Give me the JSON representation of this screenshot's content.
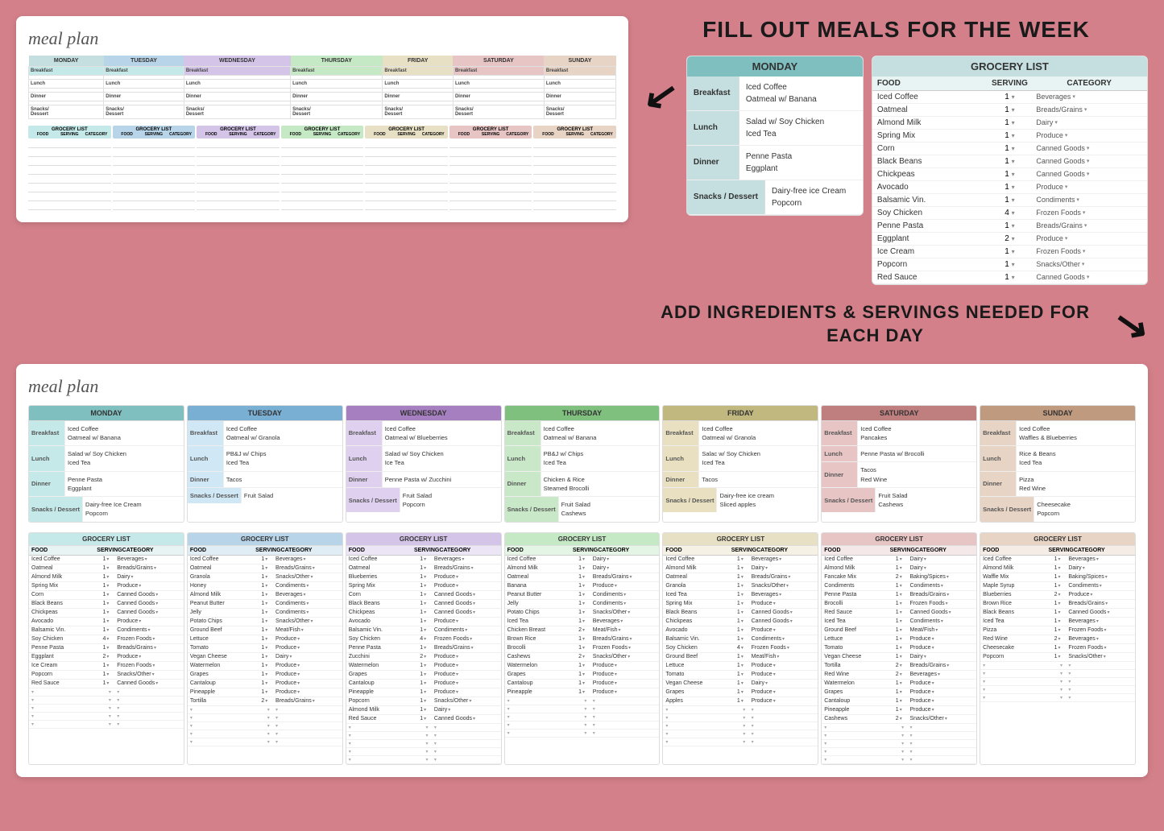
{
  "app": {
    "title": "meal plan",
    "top_heading": "FILL OUT MEALS FOR THE WEEK",
    "bottom_instructions": "ADD INGREDIENTS & SERVINGS NEEDED FOR EACH DAY"
  },
  "days": [
    "MONDAY",
    "TUESDAY",
    "WEDNESDAY",
    "THURSDAY",
    "FRIDAY",
    "SATURDAY",
    "SUNDAY"
  ],
  "day_colors": {
    "MONDAY": {
      "bg": "#7fbfbf",
      "light": "#c5e8e8"
    },
    "TUESDAY": "#7aafd4",
    "WEDNESDAY": "#a67fc0",
    "THURSDAY": "#7fc07f",
    "FRIDAY": "#c0b87f",
    "SATURDAY": "#c07f7f",
    "SUNDAY": "#c09a7f"
  },
  "monday_detail": {
    "header": "MONDAY",
    "meals": {
      "breakfast": [
        "Iced Coffee",
        "Oatmeal w/ Banana"
      ],
      "lunch": [
        "Salad w/ Soy Chicken",
        "Iced Tea"
      ],
      "dinner": [
        "Penne Pasta",
        "Eggplant"
      ],
      "snacks": [
        "Dairy-free ice Cream",
        "Popcorn"
      ]
    }
  },
  "grocery_list": {
    "header": "GROCERY LIST",
    "columns": [
      "FOOD",
      "SERVING",
      "CATEGORY"
    ],
    "items": [
      {
        "food": "Iced Coffee",
        "serving": "1",
        "category": "Beverages"
      },
      {
        "food": "Oatmeal",
        "serving": "1",
        "category": "Breads/Grains"
      },
      {
        "food": "Almond Milk",
        "serving": "1",
        "category": "Dairy"
      },
      {
        "food": "Spring Mix",
        "serving": "1",
        "category": "Produce"
      },
      {
        "food": "Corn",
        "serving": "1",
        "category": "Canned Goods"
      },
      {
        "food": "Black Beans",
        "serving": "1",
        "category": "Canned Goods"
      },
      {
        "food": "Chickpeas",
        "serving": "1",
        "category": "Canned Goods"
      },
      {
        "food": "Avocado",
        "serving": "1",
        "category": "Produce"
      },
      {
        "food": "Balsamic Vin.",
        "serving": "1",
        "category": "Condiments"
      },
      {
        "food": "Soy Chicken",
        "serving": "4",
        "category": "Frozen Foods"
      },
      {
        "food": "Penne Pasta",
        "serving": "1",
        "category": "Breads/Grains"
      },
      {
        "food": "Eggplant",
        "serving": "2",
        "category": "Produce"
      },
      {
        "food": "Ice Cream",
        "serving": "1",
        "category": "Frozen Foods"
      },
      {
        "food": "Popcorn",
        "serving": "1",
        "category": "Snacks/Other"
      },
      {
        "food": "Red Sauce",
        "serving": "1",
        "category": "Canned Goods"
      }
    ]
  },
  "full_meal_plan": {
    "monday": {
      "breakfast": [
        "Iced Coffee",
        "Oatmeal w/ Banana"
      ],
      "lunch": [
        "Salad w/ Soy Chicken",
        "Iced Tea"
      ],
      "dinner": [
        "Penne Pasta",
        "Eggplant"
      ],
      "snacks": [
        "Dairy-free Ice Cream",
        "Popcorn"
      ]
    },
    "tuesday": {
      "breakfast": [
        "Iced Coffee",
        "Oatmeal w/ Granola"
      ],
      "lunch": [
        "PB&J w/ Chips",
        "Iced Tea"
      ],
      "dinner": [
        "Tacos"
      ],
      "snacks": [
        "Fruit Salad"
      ]
    },
    "wednesday": {
      "breakfast": [
        "Iced Coffee",
        "Oatmeal w/ Blueberries"
      ],
      "lunch": [
        "Salad w/ Soy Chicken",
        "Ice Tea"
      ],
      "dinner": [
        "Penne Pasta w/ Zucchini"
      ],
      "snacks": [
        "Fruit Salad",
        "Popcorn"
      ]
    },
    "thursday": {
      "breakfast": [
        "Iced Coffee",
        "Oatmeal w/ Banana"
      ],
      "lunch": [
        "PB&J w/ Chips",
        "Iced Tea"
      ],
      "dinner": [
        "Chicken & Rice",
        "Steamed Brocolli"
      ],
      "snacks": [
        "Fruit Salad",
        "Cashews"
      ]
    },
    "friday": {
      "breakfast": [
        "Iced Coffee",
        "Oatmeal w/ Granola"
      ],
      "lunch": [
        "Salac w/ Soy Chicken",
        "Iced Tea"
      ],
      "dinner": [
        "Tacos"
      ],
      "snacks": [
        "Dairy-free ice cream",
        "Sliced apples"
      ]
    },
    "saturday": {
      "breakfast": [
        "Iced Coffee",
        "Pancakes"
      ],
      "lunch": [
        "Penne Pasta w/ Brocolli"
      ],
      "dinner": [
        "Tacos",
        "Red Wine"
      ],
      "snacks": [
        "Fruit Salad",
        "Cashews"
      ]
    },
    "sunday": {
      "breakfast": [
        "Iced Coffee",
        "Waffles & Blueberries"
      ],
      "lunch": [
        "Rice & Beans",
        "Iced Tea"
      ],
      "dinner": [
        "Pizza",
        "Red Wine"
      ],
      "snacks": [
        "Cheesecake",
        "Popcorn"
      ]
    }
  },
  "full_grocery": {
    "monday": [
      {
        "food": "Iced Coffee",
        "serving": "1",
        "category": "Beverages"
      },
      {
        "food": "Oatmeal",
        "serving": "1",
        "category": "Breads/Grains"
      },
      {
        "food": "Almond Milk",
        "serving": "1",
        "category": "Dairy"
      },
      {
        "food": "Spring Mix",
        "serving": "1",
        "category": "Produce"
      },
      {
        "food": "Corn",
        "serving": "1",
        "category": "Canned Goods"
      },
      {
        "food": "Black Beans",
        "serving": "1",
        "category": "Canned Goods"
      },
      {
        "food": "Chickpeas",
        "serving": "1",
        "category": "Canned Goods"
      },
      {
        "food": "Avocado",
        "serving": "1",
        "category": "Produce"
      },
      {
        "food": "Balsamic Vin.",
        "serving": "1",
        "category": "Condiments"
      },
      {
        "food": "Soy Chicken",
        "serving": "4",
        "category": "Frozen Foods"
      },
      {
        "food": "Penne Pasta",
        "serving": "1",
        "category": "Breads/Grains"
      },
      {
        "food": "Eggplant",
        "serving": "2",
        "category": "Produce"
      },
      {
        "food": "Ice Cream",
        "serving": "1",
        "category": "Frozen Foods"
      },
      {
        "food": "Popcorn",
        "serving": "1",
        "category": "Snacks/Other"
      },
      {
        "food": "Red Sauce",
        "serving": "1",
        "category": "Canned Goods"
      }
    ],
    "tuesday": [
      {
        "food": "Iced Coffee",
        "serving": "1",
        "category": "Beverages"
      },
      {
        "food": "Oatmeal",
        "serving": "1",
        "category": "Breads/Grains"
      },
      {
        "food": "Granola",
        "serving": "1",
        "category": "Snacks/Other"
      },
      {
        "food": "Honey",
        "serving": "1",
        "category": "Condiments"
      },
      {
        "food": "Almond Milk",
        "serving": "1",
        "category": "Beverages"
      },
      {
        "food": "Peanut Butter",
        "serving": "1",
        "category": "Condiments"
      },
      {
        "food": "Jelly",
        "serving": "1",
        "category": "Condiments"
      },
      {
        "food": "Potato Chips",
        "serving": "1",
        "category": "Snacks/Other"
      },
      {
        "food": "Ground Beef",
        "serving": "1",
        "category": "Meat/Fish"
      },
      {
        "food": "Lettuce",
        "serving": "1",
        "category": "Produce"
      },
      {
        "food": "Tomato",
        "serving": "1",
        "category": "Produce"
      },
      {
        "food": "Vegan Cheese",
        "serving": "1",
        "category": "Dairy"
      },
      {
        "food": "Watermelon",
        "serving": "1",
        "category": "Produce"
      },
      {
        "food": "Grapes",
        "serving": "1",
        "category": "Produce"
      },
      {
        "food": "Cantaloup",
        "serving": "1",
        "category": "Produce"
      },
      {
        "food": "Pineapple",
        "serving": "1",
        "category": "Produce"
      },
      {
        "food": "Tortilla",
        "serving": "2",
        "category": "Breads/Grains"
      }
    ],
    "wednesday": [
      {
        "food": "Iced Coffee",
        "serving": "1",
        "category": "Beverages"
      },
      {
        "food": "Oatmeal",
        "serving": "1",
        "category": "Breads/Grains"
      },
      {
        "food": "Blueberries",
        "serving": "1",
        "category": "Produce"
      },
      {
        "food": "Spring Mix",
        "serving": "1",
        "category": "Produce"
      },
      {
        "food": "Corn",
        "serving": "1",
        "category": "Canned Goods"
      },
      {
        "food": "Black Beans",
        "serving": "1",
        "category": "Canned Goods"
      },
      {
        "food": "Chickpeas",
        "serving": "1",
        "category": "Canned Goods"
      },
      {
        "food": "Avocado",
        "serving": "1",
        "category": "Produce"
      },
      {
        "food": "Balsamic Vin.",
        "serving": "1",
        "category": "Condiments"
      },
      {
        "food": "Soy Chicken",
        "serving": "4",
        "category": "Frozen Foods"
      },
      {
        "food": "Penne Pasta",
        "serving": "1",
        "category": "Breads/Grains"
      },
      {
        "food": "Zucchini",
        "serving": "2",
        "category": "Produce"
      },
      {
        "food": "Watermelon",
        "serving": "1",
        "category": "Produce"
      },
      {
        "food": "Grapes",
        "serving": "1",
        "category": "Produce"
      },
      {
        "food": "Cantaloup",
        "serving": "1",
        "category": "Produce"
      },
      {
        "food": "Pineapple",
        "serving": "1",
        "category": "Produce"
      },
      {
        "food": "Popcorn",
        "serving": "1",
        "category": "Snacks/Other"
      },
      {
        "food": "Almond Milk",
        "serving": "1",
        "category": "Dairy"
      },
      {
        "food": "Red Sauce",
        "serving": "1",
        "category": "Canned Goods"
      }
    ],
    "thursday": [
      {
        "food": "Iced Coffee",
        "serving": "1",
        "category": "Dairy"
      },
      {
        "food": "Almond Milk",
        "serving": "1",
        "category": "Dairy"
      },
      {
        "food": "Oatmeal",
        "serving": "1",
        "category": "Breads/Grains"
      },
      {
        "food": "Banana",
        "serving": "1",
        "category": "Produce"
      },
      {
        "food": "Peanut Butter",
        "serving": "1",
        "category": "Condiments"
      },
      {
        "food": "Jelly",
        "serving": "1",
        "category": "Condiments"
      },
      {
        "food": "Potato Chips",
        "serving": "1",
        "category": "Snacks/Other"
      },
      {
        "food": "Iced Tea",
        "serving": "1",
        "category": "Beverages"
      },
      {
        "food": "Chicken Breast",
        "serving": "2",
        "category": "Meat/Fish"
      },
      {
        "food": "Brown Rice",
        "serving": "1",
        "category": "Breads/Grains"
      },
      {
        "food": "Brocolli",
        "serving": "1",
        "category": "Frozen Foods"
      },
      {
        "food": "Cashews",
        "serving": "2",
        "category": "Snacks/Other"
      },
      {
        "food": "Watermelon",
        "serving": "1",
        "category": "Produce"
      },
      {
        "food": "Grapes",
        "serving": "1",
        "category": "Produce"
      },
      {
        "food": "Cantaloup",
        "serving": "1",
        "category": "Produce"
      },
      {
        "food": "Pineapple",
        "serving": "1",
        "category": "Produce"
      }
    ],
    "friday": [
      {
        "food": "Iced Coffee",
        "serving": "1",
        "category": "Beverages"
      },
      {
        "food": "Almond Milk",
        "serving": "1",
        "category": "Dairy"
      },
      {
        "food": "Oatmeal",
        "serving": "1",
        "category": "Breads/Grains"
      },
      {
        "food": "Granola",
        "serving": "1",
        "category": "Snacks/Other"
      },
      {
        "food": "Iced Tea",
        "serving": "1",
        "category": "Beverages"
      },
      {
        "food": "Spring Mix",
        "serving": "1",
        "category": "Produce"
      },
      {
        "food": "Black Beans",
        "serving": "1",
        "category": "Canned Goods"
      },
      {
        "food": "Chickpeas",
        "serving": "1",
        "category": "Canned Goods"
      },
      {
        "food": "Avocado",
        "serving": "1",
        "category": "Produce"
      },
      {
        "food": "Balsamic Vin.",
        "serving": "1",
        "category": "Condiments"
      },
      {
        "food": "Soy Chicken",
        "serving": "4",
        "category": "Frozen Foods"
      },
      {
        "food": "Ground Beef",
        "serving": "1",
        "category": "Meat/Fish"
      },
      {
        "food": "Lettuce",
        "serving": "1",
        "category": "Produce"
      },
      {
        "food": "Tomato",
        "serving": "1",
        "category": "Produce"
      },
      {
        "food": "Vegan Cheese",
        "serving": "1",
        "category": "Dairy"
      },
      {
        "food": "Grapes",
        "serving": "1",
        "category": "Produce"
      },
      {
        "food": "Apples",
        "serving": "1",
        "category": "Produce"
      }
    ],
    "saturday": [
      {
        "food": "Iced Coffee",
        "serving": "1",
        "category": "Dairy"
      },
      {
        "food": "Almond Milk",
        "serving": "1",
        "category": "Dairy"
      },
      {
        "food": "Fancake Mix",
        "serving": "2",
        "category": "Baking/Spices"
      },
      {
        "food": "Condiments",
        "serving": "1",
        "category": "Condiments"
      },
      {
        "food": "Penne Pasta",
        "serving": "1",
        "category": "Breads/Grains"
      },
      {
        "food": "Brocolli",
        "serving": "1",
        "category": "Frozen Foods"
      },
      {
        "food": "Red Sauce",
        "serving": "1",
        "category": "Canned Goods"
      },
      {
        "food": "Iced Tea",
        "serving": "1",
        "category": "Condiments"
      },
      {
        "food": "Ground Beef",
        "serving": "1",
        "category": "Meat/Fish"
      },
      {
        "food": "Lettuce",
        "serving": "1",
        "category": "Produce"
      },
      {
        "food": "Tomato",
        "serving": "1",
        "category": "Produce"
      },
      {
        "food": "Vegan Cheese",
        "serving": "1",
        "category": "Dairy"
      },
      {
        "food": "Tortilla",
        "serving": "2",
        "category": "Breads/Grains"
      },
      {
        "food": "Red Wine",
        "serving": "2",
        "category": "Beverages"
      },
      {
        "food": "Watermelon",
        "serving": "1",
        "category": "Produce"
      },
      {
        "food": "Grapes",
        "serving": "1",
        "category": "Produce"
      },
      {
        "food": "Cantaloup",
        "serving": "1",
        "category": "Produce"
      },
      {
        "food": "Pineapple",
        "serving": "1",
        "category": "Produce"
      },
      {
        "food": "Cashews",
        "serving": "2",
        "category": "Snacks/Other"
      }
    ],
    "sunday": [
      {
        "food": "Iced Coffee",
        "serving": "1",
        "category": "Beverages"
      },
      {
        "food": "Almond Milk",
        "serving": "1",
        "category": "Dairy"
      },
      {
        "food": "Waffle Mix",
        "serving": "1",
        "category": "Baking/Spices"
      },
      {
        "food": "Maple Syrup",
        "serving": "1",
        "category": "Condiments"
      },
      {
        "food": "Blueberries",
        "serving": "2",
        "category": "Produce"
      },
      {
        "food": "Brown Rice",
        "serving": "1",
        "category": "Breads/Grains"
      },
      {
        "food": "Black Beans",
        "serving": "1",
        "category": "Canned Goods"
      },
      {
        "food": "Iced Tea",
        "serving": "1",
        "category": "Beverages"
      },
      {
        "food": "Pizza",
        "serving": "1",
        "category": "Frozen Foods"
      },
      {
        "food": "Red Wine",
        "serving": "2",
        "category": "Beverages"
      },
      {
        "food": "Cheesecake",
        "serving": "1",
        "category": "Frozen Foods"
      },
      {
        "food": "Popcorn",
        "serving": "1",
        "category": "Snacks/Other"
      }
    ]
  }
}
